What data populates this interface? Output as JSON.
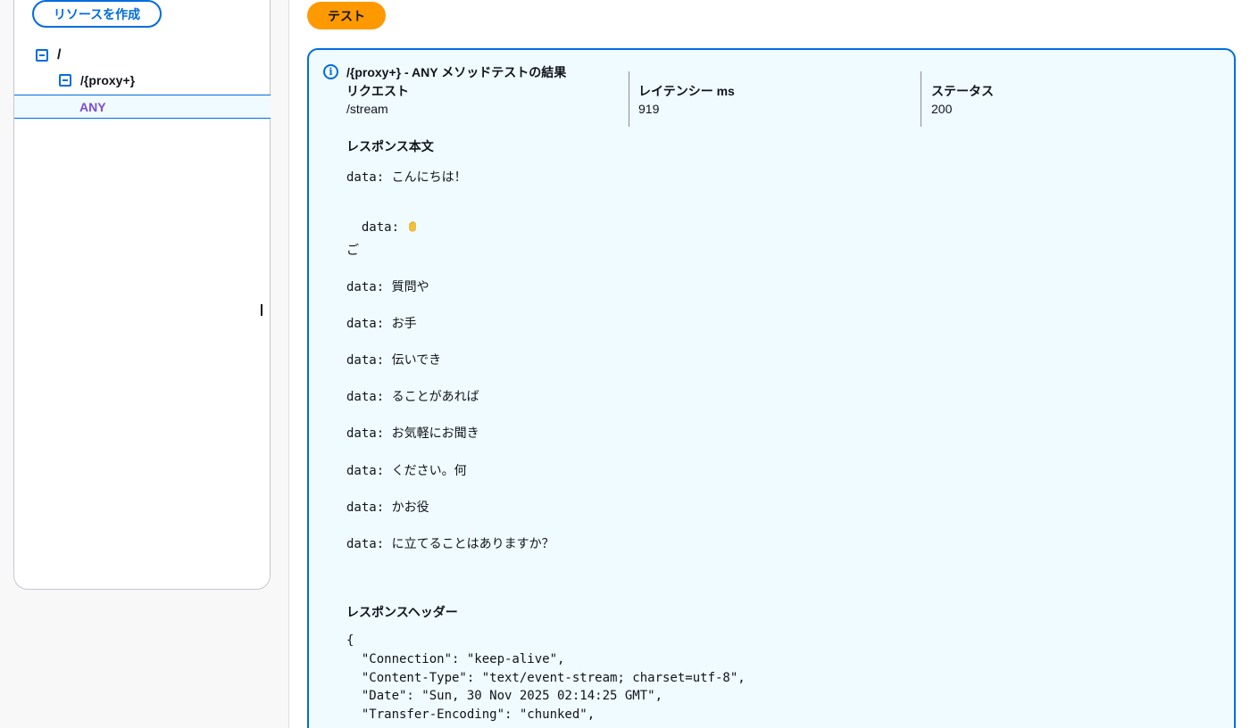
{
  "sidebar": {
    "create_resource_label": "リソースを作成",
    "tree": {
      "root": "/",
      "proxy": "/{proxy+}",
      "method": "ANY"
    }
  },
  "main": {
    "test_button_label": "テスト",
    "result": {
      "title": "/{proxy+} - ANY メソッドテストの結果",
      "request_label": "リクエスト",
      "request_value": "/stream",
      "latency_label": "レイテンシー ms",
      "latency_value": "919",
      "status_label": "ステータス",
      "status_value": "200",
      "response_body_title": "レスポンス本文",
      "body_lines": [
        "data: こんにちは！",
        "data: ",
        "ご",
        "data: 質問や",
        "data: お手",
        "data: 伝いでき",
        "data: ることがあれば",
        "data: お気軽にお聞き",
        "data: ください。何",
        "data: かお役",
        "data: に立てることはありますか？"
      ],
      "wave_emoji_icon": "waving-hand-icon",
      "response_headers_title": "レスポンスヘッダー",
      "header_lines": [
        "{",
        "  \"Connection\": \"keep-alive\",",
        "  \"Content-Type\": \"text/event-stream; charset=utf-8\",",
        "  \"Date\": \"Sun, 30 Nov 2025 02:14:25 GMT\",",
        "  \"Transfer-Encoding\": \"chunked\","
      ]
    }
  }
}
